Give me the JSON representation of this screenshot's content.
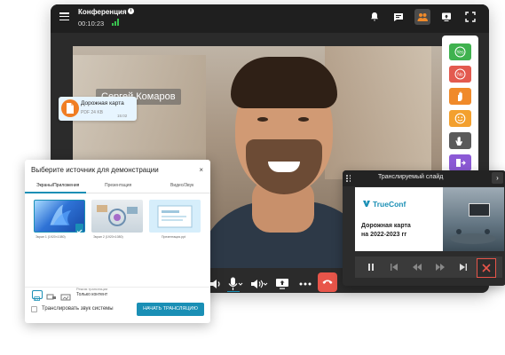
{
  "conference": {
    "title": "Конференция",
    "timer": "00:10:23",
    "participant_name": "Сергей Комаров"
  },
  "header_icons": [
    "hamburger-menu-icon",
    "info-icon",
    "signal-icon",
    "bell-icon",
    "chat-icon",
    "participants-icon",
    "share-screen-icon",
    "fullscreen-icon"
  ],
  "reactions": [
    {
      "icon": "vote-yes-icon",
      "color": "#3fb24f"
    },
    {
      "icon": "vote-no-icon",
      "color": "#e35a4f"
    },
    {
      "icon": "raise-hand-icon",
      "color": "#f08a2a"
    },
    {
      "icon": "smile-icon",
      "color": "#f3a02e"
    },
    {
      "icon": "applause-icon",
      "color": "#5a5a5a"
    },
    {
      "icon": "exit-icon",
      "color": "#8c5ad6"
    }
  ],
  "file_message": {
    "name": "Дорожная карта",
    "size": "PDF 24 KB",
    "time": "15:02"
  },
  "source_dialog": {
    "title": "Выберите источник для демонстрации",
    "close": "×",
    "tabs": [
      "Экраны/Приложения",
      "Презентация",
      "Видео/Звук"
    ],
    "active_tab": 0,
    "thumbnails": [
      {
        "label": "Экран 1 (1920×1080)",
        "selected": true
      },
      {
        "label": "Экран 2 (1920×1080)",
        "selected": false
      },
      {
        "label": "Презентация.ppt",
        "selected": false
      }
    ],
    "mode_label": "Режим трансляции",
    "mode_value": "Только контент",
    "checkbox_label": "Транслировать звук системы",
    "start_button": "НАЧАТЬ ТРАНСЛЯЦИЮ"
  },
  "slide_panel": {
    "title": "Транслируемый слайд",
    "brand": "TrueConf",
    "slide_line1": "Дорожная карта",
    "slide_line2": "на 2022-2023 гг"
  },
  "colors": {
    "accent": "#1a8fb5",
    "danger": "#e8554a",
    "window_bg": "#2b2b2b"
  }
}
